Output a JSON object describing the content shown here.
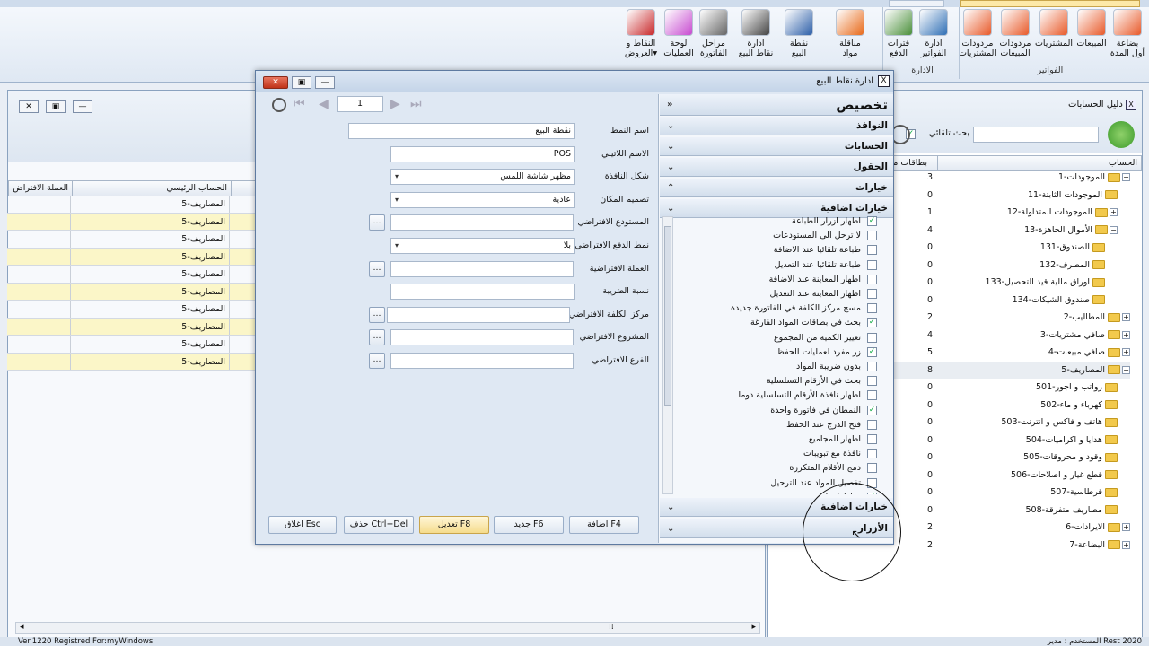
{
  "ribbon": {
    "items": [
      {
        "label": "بضاعة\nأول المدة"
      },
      {
        "label": "المبيعات"
      },
      {
        "label": "المشتريات"
      },
      {
        "label": "مردودات\nالمبيعات"
      },
      {
        "label": "مردودات\nالمشتريات"
      },
      {
        "label": "ادارة\nالفواتير"
      },
      {
        "label": "فترات\nالدفع"
      },
      {
        "label": "مناقلة\nمواد"
      },
      {
        "label": "نقطة\nالبيع"
      },
      {
        "label": "ادارة\nنقاط البيع"
      },
      {
        "label": "مراحل\nالفاتورة"
      },
      {
        "label": "لوحة\nالعمليات"
      },
      {
        "label": "النقاط و\nالعروض▾"
      }
    ],
    "group_invoices": "الفواتير",
    "group_admin": "الادارة"
  },
  "left_window": {
    "col_main_account": "الحساب الرئيسي",
    "col_default_currency": "العملة الافتراض",
    "rows": [
      "5-المصاريف",
      "5-المصاريف",
      "5-المصاريف",
      "5-المصاريف",
      "5-المصاريف",
      "5-المصاريف",
      "5-المصاريف",
      "5-المصاريف",
      "5-المصاريف",
      "5-المصاريف"
    ]
  },
  "accounts": {
    "title": "دليل الحسابات",
    "search_label": "بحث تلقائي",
    "col_account": "الحساب",
    "col_cards": "بطاقات مر",
    "tree": [
      {
        "label": "1-الموجودات",
        "num": "3",
        "lvl": 0,
        "exp": "−"
      },
      {
        "label": "11-الموجودات الثابتة",
        "num": "0",
        "lvl": 1,
        "exp": ""
      },
      {
        "label": "12-الموجودات المتداولة",
        "num": "1",
        "lvl": 1,
        "exp": "+"
      },
      {
        "label": "13-الأموال الجاهزة",
        "num": "4",
        "lvl": 1,
        "exp": "−"
      },
      {
        "label": "131-الصندوق",
        "num": "0",
        "lvl": 2,
        "exp": ""
      },
      {
        "label": "132-المصرف",
        "num": "0",
        "lvl": 2,
        "exp": ""
      },
      {
        "label": "133-اوراق مالية قيد التحصيل",
        "num": "0",
        "lvl": 2,
        "exp": ""
      },
      {
        "label": "134-صندوق الشيكات",
        "num": "0",
        "lvl": 2,
        "exp": ""
      },
      {
        "label": "2-المطاليب",
        "num": "2",
        "lvl": 0,
        "exp": "+"
      },
      {
        "label": "3-صافي مشتريات",
        "num": "4",
        "lvl": 0,
        "exp": "+"
      },
      {
        "label": "4-صافي مبيعات",
        "num": "5",
        "lvl": 0,
        "exp": "+"
      },
      {
        "label": "5-المصاريف",
        "num": "8",
        "lvl": 0,
        "exp": "−",
        "sel": true
      },
      {
        "label": "501-رواتب و اجور",
        "num": "0",
        "lvl": 1,
        "exp": ""
      },
      {
        "label": "502-كهرباء و ماء",
        "num": "0",
        "lvl": 1,
        "exp": ""
      },
      {
        "label": "503-هاتف و فاكس و انترنت",
        "num": "0",
        "lvl": 1,
        "exp": ""
      },
      {
        "label": "504-هدايا و اكراميات",
        "num": "0",
        "lvl": 1,
        "exp": ""
      },
      {
        "label": "505-وقود و محروقات",
        "num": "0",
        "lvl": 1,
        "exp": ""
      },
      {
        "label": "506-قطع غيار و اصلاحات",
        "num": "0",
        "lvl": 1,
        "exp": ""
      },
      {
        "label": "507-قرطاسية",
        "num": "0",
        "lvl": 1,
        "exp": ""
      },
      {
        "label": "508-مصاريف متفرقة",
        "num": "0",
        "lvl": 1,
        "exp": ""
      },
      {
        "label": "6-الايرادات",
        "num": "2",
        "lvl": 0,
        "exp": "+"
      },
      {
        "label": "7-البضاعة",
        "num": "2",
        "lvl": 0,
        "exp": "+"
      }
    ]
  },
  "dialog": {
    "title": "ادارة نقاط البيع",
    "record": "1",
    "fields": [
      {
        "label": "اسم النمط",
        "value": "نقطة البيع",
        "type": "text"
      },
      {
        "label": "الاسم اللاتيني",
        "value": "POS",
        "type": "text"
      },
      {
        "label": "شكل النافذة",
        "value": "مظهر شاشة اللمس",
        "type": "select"
      },
      {
        "label": "تصميم المكان",
        "value": "عادية",
        "type": "select"
      },
      {
        "label": "المستودع الافتراضي",
        "value": "",
        "type": "lookup"
      },
      {
        "label": "نمط الدفع الافتراضي",
        "value": "بلا",
        "type": "select"
      },
      {
        "label": "العملة الافتراضية",
        "value": "",
        "type": "lookup"
      },
      {
        "label": "نسبة الضريبة",
        "value": "",
        "type": "text"
      },
      {
        "label": "مركز الكلفة الافتراضي",
        "value": "",
        "type": "lookup"
      },
      {
        "label": "المشروع الافتراضي",
        "value": "",
        "type": "lookup"
      },
      {
        "label": "الفرع الافتراضي",
        "value": "",
        "type": "lookup"
      }
    ],
    "buttons": {
      "add": "اضافة F4",
      "new": "جديد F6",
      "edit": "تعديل F8",
      "delete": "حذف Ctrl+Del",
      "close": "اغلاق Esc"
    },
    "panel": {
      "customize": "تخصيص",
      "windows": "النوافذ",
      "accounts": "الحسابات",
      "fields": "الحقول",
      "options": "خيارات",
      "extra_options": "خيارات اضافية",
      "extra_options_2": "خيارات اضافية",
      "buttons": "الأزرار",
      "options_list": [
        {
          "label": "اظهار ازرار الطباعة",
          "checked": true
        },
        {
          "label": "لا ترحل الى المستودعات",
          "checked": false
        },
        {
          "label": "طباعة تلقائيا عند الاضافة",
          "checked": false
        },
        {
          "label": "طباعة تلقائيا عند التعديل",
          "checked": false
        },
        {
          "label": "اظهار المعاينة عند الاضافة",
          "checked": false
        },
        {
          "label": "اظهار المعاينة عند التعديل",
          "checked": false
        },
        {
          "label": "مسح مركز الكلفة في الفاتورة جديدة",
          "checked": false
        },
        {
          "label": "بحث في بطاقات المواد الفارغة",
          "checked": true
        },
        {
          "label": "تغيير الكمية من المجموع",
          "checked": false
        },
        {
          "label": "زر مفرد لعمليات الحفظ",
          "checked": true
        },
        {
          "label": "بدون ضريبة المواد",
          "checked": false
        },
        {
          "label": "بحث في الأرقام التسلسلية",
          "checked": false
        },
        {
          "label": "اظهار نافذة الأرقام التسلسلية دوما",
          "checked": false
        },
        {
          "label": "النمطان في فاتورة واحدة",
          "checked": true
        },
        {
          "label": "فتح الدرج عند الحفظ",
          "checked": false
        },
        {
          "label": "اظهار المجاميع",
          "checked": false
        },
        {
          "label": "نافذة مع تبويبات",
          "checked": false
        },
        {
          "label": "دمج الأقلام المتكررة",
          "checked": false
        },
        {
          "label": "تفصيل المواد عند الترحيل",
          "checked": false
        },
        {
          "label": "اظهار الد...",
          "checked": true
        }
      ]
    }
  },
  "status": {
    "left": "Ver.1220 Registred For:myWindows",
    "right": "المستخدم : مدير   Rest 2020"
  }
}
